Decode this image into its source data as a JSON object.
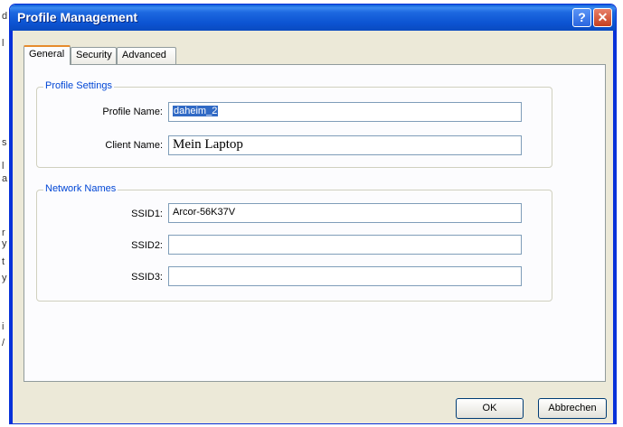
{
  "window": {
    "title": "Profile Management",
    "help_label": "?",
    "close_label": "✕"
  },
  "background": {
    "chars": [
      "d",
      "l",
      "s",
      "l",
      "a",
      "r",
      "y",
      "t",
      "y",
      "i",
      "/"
    ]
  },
  "tabs": [
    {
      "label": "General",
      "active": true
    },
    {
      "label": "Security",
      "active": false
    },
    {
      "label": "Advanced",
      "active": false
    }
  ],
  "profile_settings": {
    "group_label": "Profile Settings",
    "profile_name_label": "Profile Name:",
    "profile_name_value": "daheim_2",
    "client_name_label": "Client Name:",
    "client_name_value": "Mein Laptop"
  },
  "network_names": {
    "group_label": "Network Names",
    "ssid1_label": "SSID1:",
    "ssid1_value": "Arcor-56K37V",
    "ssid2_label": "SSID2:",
    "ssid2_value": "",
    "ssid3_label": "SSID3:",
    "ssid3_value": ""
  },
  "buttons": {
    "ok_label": "OK",
    "cancel_label": "Abbrechen"
  }
}
